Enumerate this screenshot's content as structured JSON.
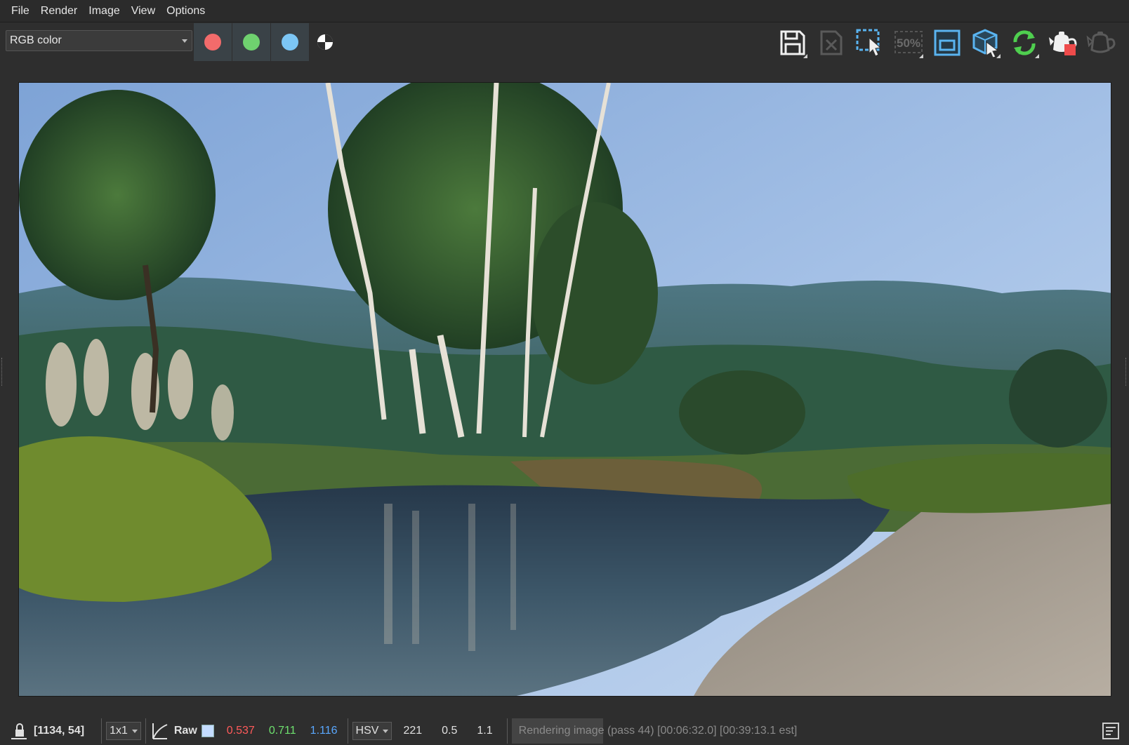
{
  "menu": [
    "File",
    "Render",
    "Image",
    "View",
    "Options"
  ],
  "toolbar": {
    "channel_mode": "RGB color",
    "channels": [
      {
        "name": "red",
        "color": "#f26b6b"
      },
      {
        "name": "green",
        "color": "#6fd16f"
      },
      {
        "name": "blue",
        "color": "#7cc6f5"
      }
    ],
    "tools": [
      {
        "icon": "save-icon",
        "disabled": false
      },
      {
        "icon": "clear-icon",
        "disabled": true
      },
      {
        "icon": "region-select-icon",
        "disabled": false
      },
      {
        "icon": "zoom-50-icon",
        "label": "50%",
        "disabled": true
      },
      {
        "icon": "frame-icon",
        "disabled": false
      },
      {
        "icon": "select-object-icon",
        "disabled": false
      },
      {
        "icon": "refresh-icon",
        "disabled": false
      },
      {
        "icon": "render-teapot-icon",
        "disabled": false
      },
      {
        "icon": "teapot-icon",
        "disabled": true
      }
    ]
  },
  "status": {
    "coords": "[1134, 54]",
    "sample_size": "1x1",
    "raw_label": "Raw",
    "swatch_color": "#c4dcff",
    "r": "0.537",
    "g": "0.711",
    "b": "1.116",
    "color_space": "HSV",
    "h": "221",
    "s": "0.5",
    "v": "1.1",
    "progress_fraction": 0.31,
    "progress_text": "Rendering image (pass 44) [00:06:32.0] [00:39:13.1 est]"
  }
}
